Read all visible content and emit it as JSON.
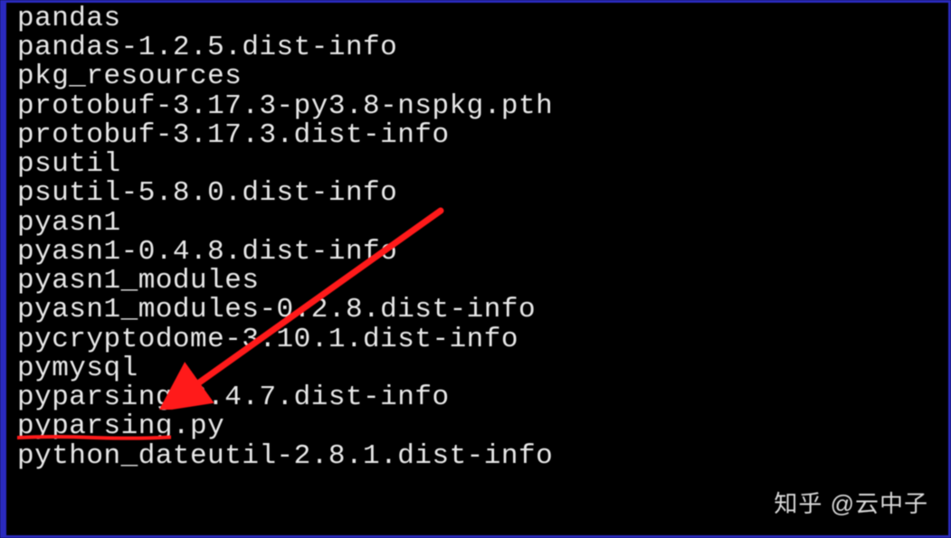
{
  "lines": [
    "pandas",
    "pandas-1.2.5.dist-info",
    "pkg_resources",
    "protobuf-3.17.3-py3.8-nspkg.pth",
    "protobuf-3.17.3.dist-info",
    "psutil",
    "psutil-5.8.0.dist-info",
    "pyasn1",
    "pyasn1-0.4.8.dist-info",
    "pyasn1_modules",
    "pyasn1_modules-0.2.8.dist-info",
    "pycryptodome-3.10.1.dist-info",
    "pymysql",
    "pyparsing-2.4.7.dist-info",
    "pyparsing.py",
    "python_dateutil-2.8.1.dist-info"
  ],
  "highlighted_line_index": 12,
  "annotation": {
    "arrow_color": "#ff1a1a",
    "underline_color": "#ff1a1a"
  },
  "watermark": "知乎 @云中子"
}
